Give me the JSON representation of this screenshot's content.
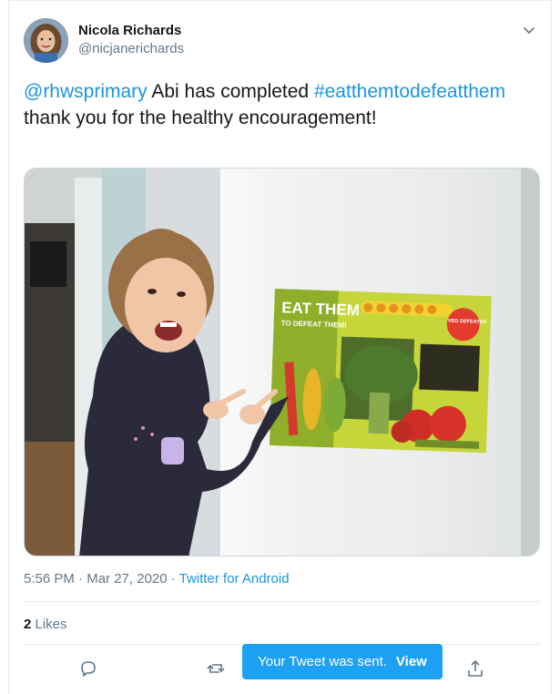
{
  "author": {
    "name": "Nicola Richards",
    "handle": "@nicjanerichards"
  },
  "tweet": {
    "mention": "@rhwsprimary",
    "text_1": " Abi has completed ",
    "hashtag": "#eatthemtodefeatthem",
    "text_2": " thank you for the healthy encouragement!"
  },
  "poster": {
    "line1": "EAT THEM",
    "line2": "TO DEFEAT THEM!",
    "badge": "VEG DEFEATED"
  },
  "meta": {
    "time": "5:56 PM",
    "separator": " · ",
    "date": "Mar 27, 2020",
    "source": "Twitter for Android"
  },
  "likes": {
    "count": "2",
    "label": " Likes"
  },
  "toast": {
    "message": "Your Tweet was sent.",
    "action": "View"
  },
  "icons": {
    "more": "chevron-down-icon",
    "reply": "reply-icon",
    "retweet": "retweet-icon",
    "share": "share-icon"
  },
  "colors": {
    "link": "#1b95e0",
    "toast": "#1da1f2",
    "secondary": "#657786"
  }
}
